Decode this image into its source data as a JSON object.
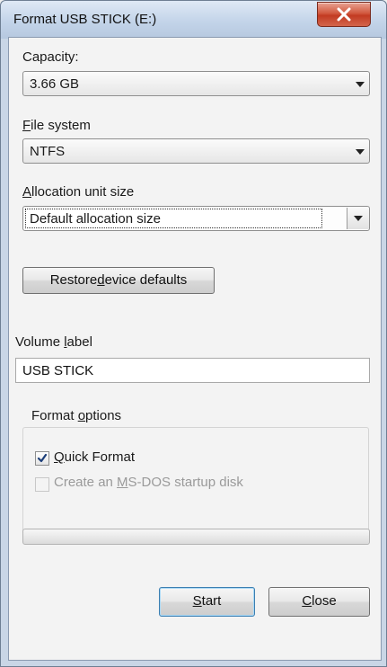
{
  "window": {
    "title": "Format USB STICK (E:)"
  },
  "capacity": {
    "label": "Capacity:",
    "value": "3.66 GB"
  },
  "file_system": {
    "label_underlined": "F",
    "label_rest": "ile system",
    "value": "NTFS"
  },
  "allocation": {
    "label_underlined": "A",
    "label_rest": "llocation unit size",
    "value": "Default allocation size"
  },
  "restore_button": {
    "label_before": "Restore ",
    "label_underlined": "d",
    "label_after": "evice defaults"
  },
  "volume_label": {
    "label_before": "Volume ",
    "label_underlined": "l",
    "label_after": "abel",
    "value": "USB STICK"
  },
  "format_options": {
    "title_before": "Format ",
    "title_underlined": "o",
    "title_after": "ptions",
    "quick_format": {
      "label_underlined": "Q",
      "label_rest": "uick Format",
      "checked": true
    },
    "msdos_startup": {
      "label_before": "Create an ",
      "label_underlined": "M",
      "label_after": "S-DOS startup disk",
      "checked": false,
      "enabled": false
    }
  },
  "progress": {
    "value": 0
  },
  "start_button": {
    "label_underlined": "S",
    "label_rest": "tart"
  },
  "close_button": {
    "label_underlined": "C",
    "label_rest": "lose"
  },
  "colors": {
    "title_gradient_top": "#dfe9f5",
    "close_red": "#c23b22",
    "default_button_border": "#3c7fb1"
  }
}
